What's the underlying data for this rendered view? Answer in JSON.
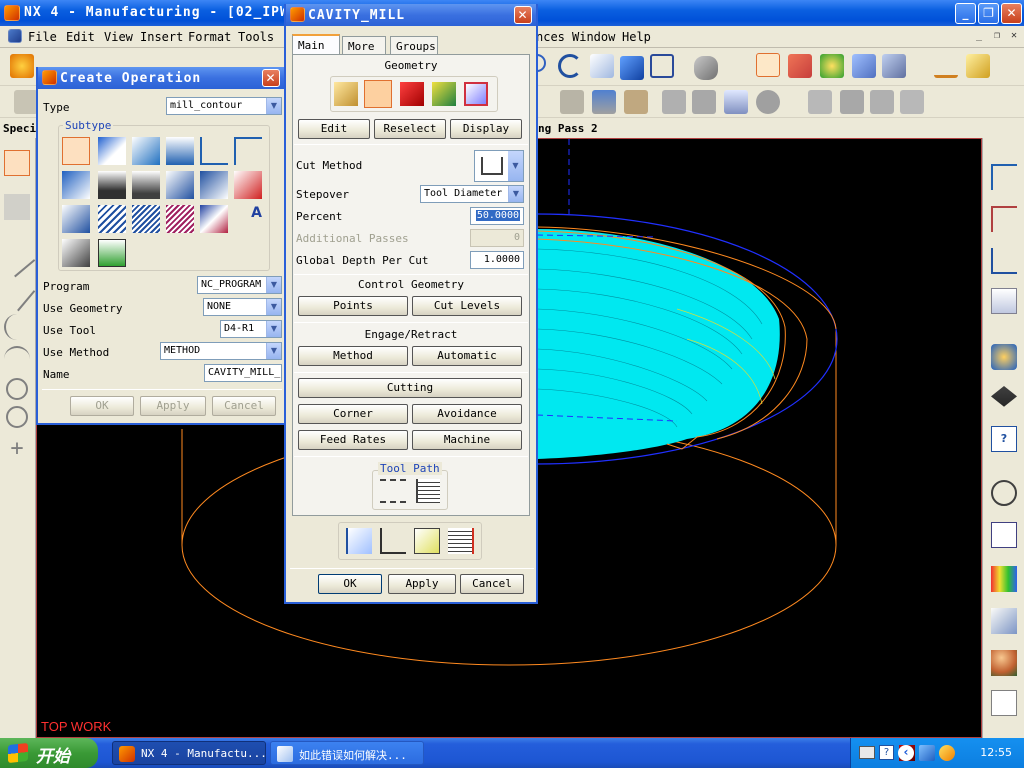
{
  "main_window": {
    "title": "NX 4 - Manufacturing - [02_IPW.pr"
  },
  "menubar": {
    "items": [
      "File",
      "Edit",
      "View",
      "Insert",
      "Format",
      "Tools"
    ],
    "items_right": [
      "nces",
      "Window",
      "Help"
    ]
  },
  "spec_bar": {
    "left_text": "Speci",
    "right_text": "ng Pass 2"
  },
  "viewport": {
    "label": "TOP WORK"
  },
  "create_operation": {
    "title": "Create Operation",
    "type_label": "Type",
    "type_value": "mill_contour",
    "subtype_label": "Subtype",
    "program_label": "Program",
    "program_value": "NC_PROGRAM",
    "use_geometry_label": "Use Geometry",
    "use_geometry_value": "NONE",
    "use_tool_label": "Use Tool",
    "use_tool_value": "D4-R1",
    "use_method_label": "Use Method",
    "use_method_value": "METHOD",
    "name_label": "Name",
    "name_value": "CAVITY_MILL_",
    "ok": "OK",
    "apply": "Apply",
    "cancel": "Cancel"
  },
  "cavity_mill": {
    "title": "CAVITY_MILL",
    "tabs": [
      "Main",
      "More",
      "Groups"
    ],
    "geometry_label": "Geometry",
    "edit": "Edit",
    "reselect": "Reselect",
    "display": "Display",
    "cut_method_label": "Cut Method",
    "stepover_label": "Stepover",
    "stepover_value": "Tool Diameter",
    "percent_label": "Percent",
    "percent_value": "50.0000",
    "additional_passes_label": "Additional Passes",
    "additional_passes_value": "0",
    "global_depth_label": "Global Depth Per Cut",
    "global_depth_value": "1.0000",
    "control_geometry_label": "Control Geometry",
    "points": "Points",
    "cut_levels": "Cut Levels",
    "engage_retract_label": "Engage/Retract",
    "method": "Method",
    "automatic": "Automatic",
    "cutting": "Cutting",
    "corner": "Corner",
    "avoidance": "Avoidance",
    "feed_rates": "Feed Rates",
    "machine": "Machine",
    "tool_path_label": "Tool Path",
    "ok": "OK",
    "apply": "Apply",
    "cancel": "Cancel"
  },
  "taskbar": {
    "start_label": "开始",
    "task1": "NX 4 - Manufactu...",
    "task2": "如此错误如何解决...",
    "clock": "12:55"
  },
  "colors": {
    "toolpath": "#00e8f0",
    "part_outline": "#ff8a20",
    "blank_outline": "#2030ff",
    "view_label": "#ff3030"
  }
}
